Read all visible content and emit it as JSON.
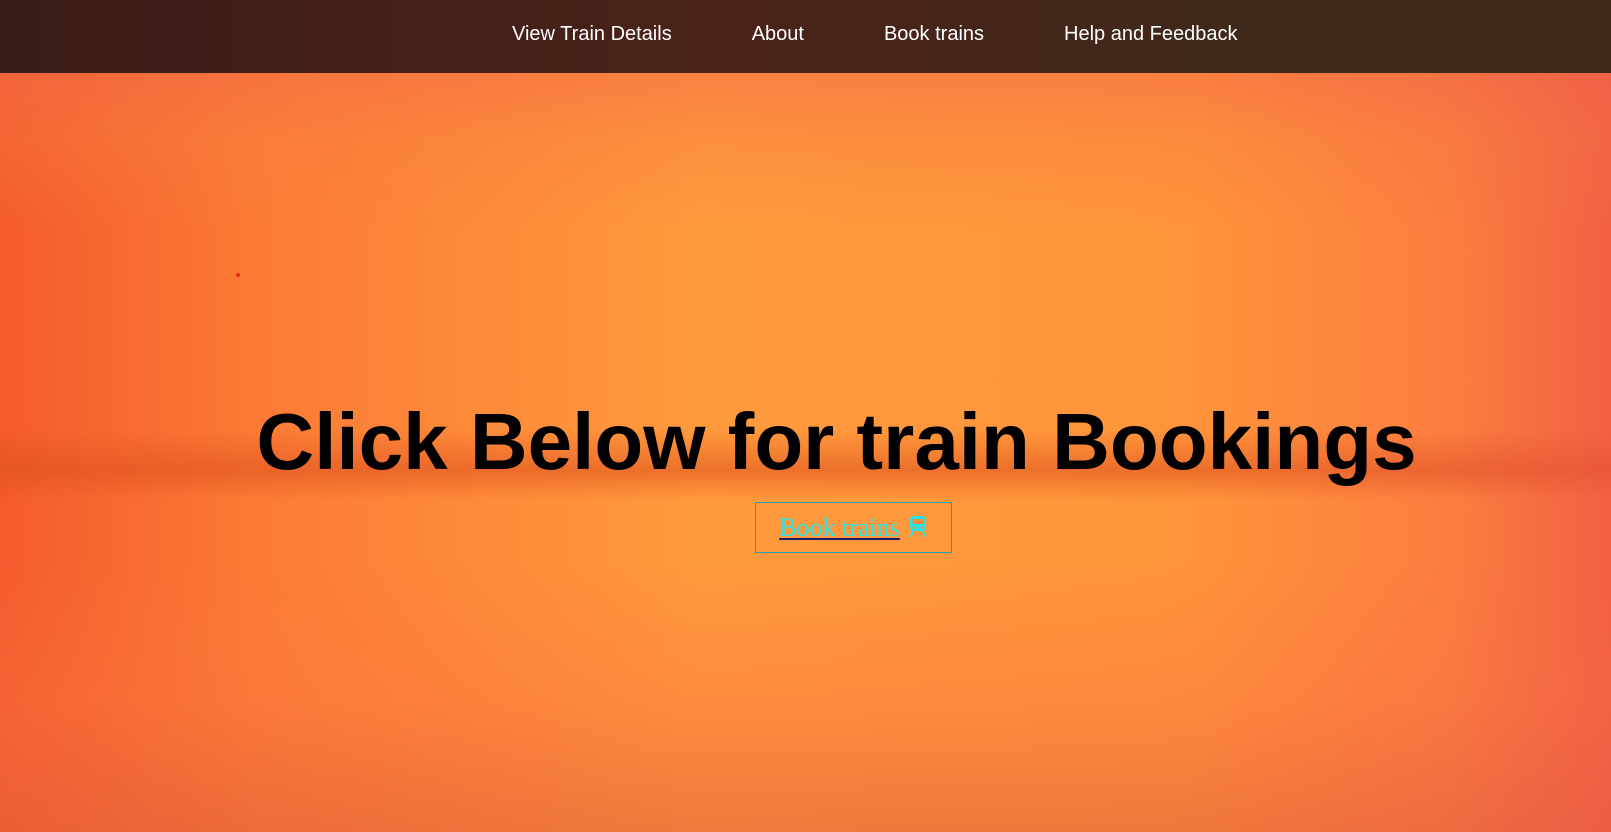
{
  "nav": {
    "items": [
      {
        "label": "View Train Details"
      },
      {
        "label": "About"
      },
      {
        "label": "Book trains"
      },
      {
        "label": "Help and Feedback"
      }
    ]
  },
  "hero": {
    "headline": "Click Below for train Bookings",
    "cta": {
      "label": "Book trains",
      "icon": "train-icon"
    }
  },
  "colors": {
    "nav_background": "#3f2119",
    "nav_text": "#ffffff",
    "background_orange": "#f47a3e",
    "headline": "#000000",
    "cta_text": "#21e6ea",
    "cta_border": "#1fa0b3"
  }
}
